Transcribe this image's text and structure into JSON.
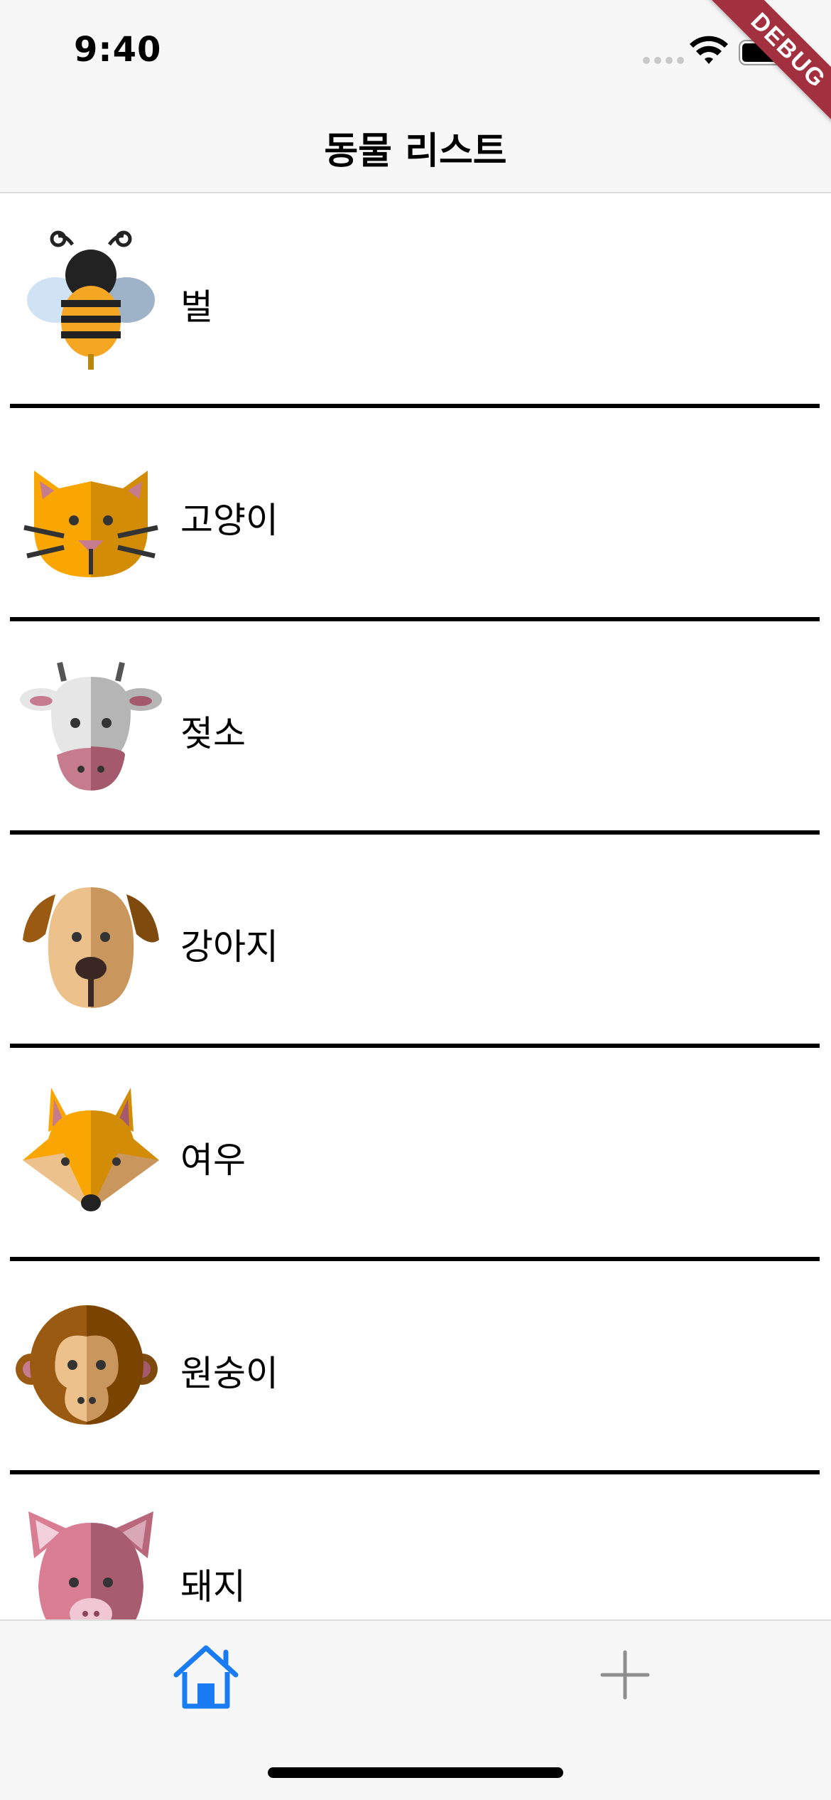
{
  "status_bar": {
    "time": "9:40"
  },
  "debug_banner": "DEBUG",
  "nav": {
    "title": "동물 리스트"
  },
  "animals": [
    {
      "name": "벌",
      "icon": "bee-icon"
    },
    {
      "name": "고양이",
      "icon": "cat-icon"
    },
    {
      "name": "젖소",
      "icon": "cow-icon"
    },
    {
      "name": "강아지",
      "icon": "dog-icon"
    },
    {
      "name": "여우",
      "icon": "fox-icon"
    },
    {
      "name": "원숭이",
      "icon": "monkey-icon"
    },
    {
      "name": "돼지",
      "icon": "pig-icon"
    }
  ],
  "tab_bar": {
    "tabs": [
      {
        "icon": "home-icon",
        "active": true,
        "color": "#1a7cf5"
      },
      {
        "icon": "plus-icon",
        "active": false,
        "color": "#8e8e8e"
      }
    ]
  }
}
